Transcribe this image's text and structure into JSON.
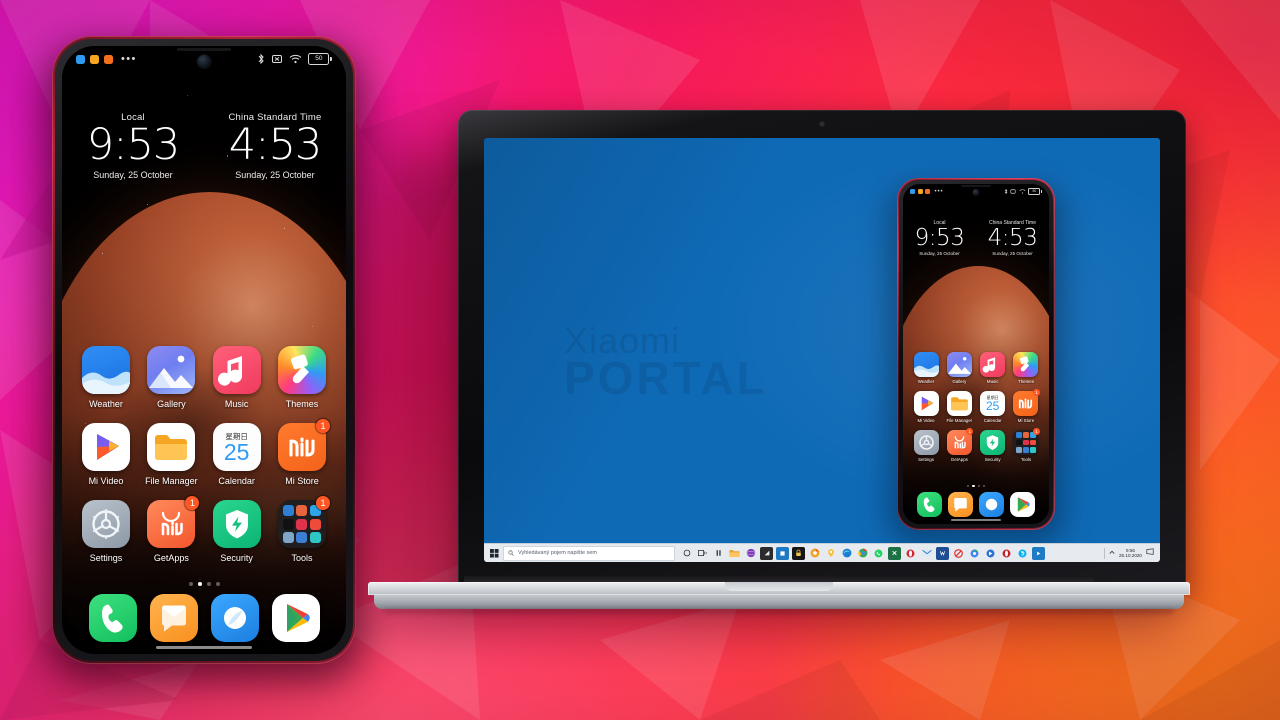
{
  "scene": {
    "title": "Xiaomi Mi Portal screen mirroring promo",
    "background_colors": {
      "magenta": "#ef1bbd",
      "red": "#fa1f3c",
      "orange": "#ff6a1e"
    }
  },
  "phone": {
    "status_bar": {
      "left_chips": [
        "#2e9bf0",
        "#f5a623",
        "#f5701e"
      ],
      "overflow_dots": "•••",
      "right_icons": [
        "bluetooth-icon",
        "vibrate-icon",
        "wifi-icon",
        "battery-icon"
      ],
      "battery_level": "50"
    },
    "clocks": [
      {
        "zone": "Local",
        "time": "9:53",
        "date": "Sunday, 25 October"
      },
      {
        "zone": "China Standard Time",
        "time": "4:53",
        "date": "Sunday, 25 October"
      }
    ],
    "apps": [
      [
        {
          "label": "Weather",
          "icon": "weather-icon",
          "badge": null
        },
        {
          "label": "Gallery",
          "icon": "gallery-icon",
          "badge": null
        },
        {
          "label": "Music",
          "icon": "music-icon",
          "badge": null
        },
        {
          "label": "Themes",
          "icon": "themes-icon",
          "badge": null
        }
      ],
      [
        {
          "label": "Mi Video",
          "icon": "mi-video-icon",
          "badge": null
        },
        {
          "label": "File Manager",
          "icon": "file-manager-icon",
          "badge": null
        },
        {
          "label": "Calendar",
          "icon": "calendar-icon",
          "badge": null,
          "day_label": "星期日",
          "day_number": "25"
        },
        {
          "label": "Mi Store",
          "icon": "mi-store-icon",
          "badge": "1"
        }
      ],
      [
        {
          "label": "Settings",
          "icon": "settings-icon",
          "badge": null
        },
        {
          "label": "GetApps",
          "icon": "getapps-icon",
          "badge": "1"
        },
        {
          "label": "Security",
          "icon": "security-icon",
          "badge": null
        },
        {
          "label": "Tools",
          "icon": "tools-folder-icon",
          "badge": "1"
        }
      ]
    ],
    "page_dots": {
      "count": 4,
      "active_index": 1
    },
    "dock": [
      {
        "label": "Phone",
        "icon": "phone-icon"
      },
      {
        "label": "Messages",
        "icon": "messages-icon"
      },
      {
        "label": "Browser",
        "icon": "browser-icon"
      },
      {
        "label": "Play Store",
        "icon": "play-store-icon"
      }
    ],
    "search_bar": {
      "search_icon": "search-icon",
      "assistant_icon": "assistant-icon"
    }
  },
  "laptop": {
    "screen": {
      "background_color": "#0f6ab6",
      "watermark_line1": "Xiaomi",
      "watermark_line2": "PORTAL"
    },
    "taskbar": {
      "start_icon": "windows-start-icon",
      "search_placeholder": "Vyhledávaný pojem napište sem",
      "search_icon": "search-icon",
      "pinned_icons": [
        {
          "name": "cortana-icon",
          "color": "#e7ebf0",
          "glyph": "◯"
        },
        {
          "name": "task-view-icon",
          "color": "#e7ebf0",
          "glyph": "❑"
        },
        {
          "name": "widgets-icon",
          "color": "#e7ebf0",
          "glyph": "‖"
        },
        {
          "name": "file-explorer-icon",
          "color": "#f2b544",
          "glyph": ""
        },
        {
          "name": "sphere-icon",
          "color": "#7b3fb5",
          "glyph": ""
        },
        {
          "name": "dark-app-icon",
          "color": "#2b2b2b",
          "glyph": "◥"
        },
        {
          "name": "teams-icon",
          "color": "#1f7ac4",
          "glyph": "■"
        },
        {
          "name": "lock-app-icon",
          "color": "#1a1a1a",
          "glyph": "🔒"
        },
        {
          "name": "chrome-canary-icon",
          "color": "#f05a28",
          "glyph": ""
        },
        {
          "name": "maps-pin-icon",
          "color": "#f7c948",
          "glyph": ""
        },
        {
          "name": "edge-icon",
          "color": "#1a7fd4",
          "glyph": ""
        },
        {
          "name": "chrome-icon",
          "color": "#ea4335",
          "glyph": ""
        },
        {
          "name": "whatsapp-icon",
          "color": "#25d366",
          "glyph": ""
        },
        {
          "name": "excel-icon",
          "color": "#1e7145",
          "glyph": ""
        },
        {
          "name": "opera-icon",
          "color": "#d6232c",
          "glyph": ""
        },
        {
          "name": "mail-icon",
          "color": "#1665c0",
          "glyph": ""
        },
        {
          "name": "word-icon",
          "color": "#1e4d91",
          "glyph": ""
        },
        {
          "name": "no-entry-icon",
          "color": "#e03131",
          "glyph": ""
        },
        {
          "name": "chrome-beta-icon",
          "color": "#4285f4",
          "glyph": ""
        },
        {
          "name": "store-icon",
          "color": "#2b6fd0",
          "glyph": ""
        },
        {
          "name": "opera-gx-icon",
          "color": "#c5202a",
          "glyph": ""
        },
        {
          "name": "skype-icon",
          "color": "#00aff0",
          "glyph": ""
        },
        {
          "name": "media-player-icon",
          "color": "#1f7ac4",
          "glyph": "▶"
        }
      ],
      "tray": {
        "show_hidden_icon": "chevron-up-icon",
        "clock_time": "9:56",
        "clock_date": "25.10.2020",
        "notifications_icon": "action-center-icon"
      }
    }
  },
  "mirror": {
    "status_bar": {
      "left_chips": [
        "#2e9bf0",
        "#f5a623",
        "#f5701e"
      ],
      "overflow_dots": "•••",
      "battery_level": "50"
    },
    "clocks": [
      {
        "zone": "Local",
        "time": "9:53",
        "date": "Sunday, 25 October"
      },
      {
        "zone": "China Standard Time",
        "time": "4:53",
        "date": "Sunday, 25 October"
      }
    ],
    "apps": [
      [
        {
          "label": "Weather",
          "icon": "weather-icon",
          "badge": null
        },
        {
          "label": "Gallery",
          "icon": "gallery-icon",
          "badge": null
        },
        {
          "label": "Music",
          "icon": "music-icon",
          "badge": null
        },
        {
          "label": "Themes",
          "icon": "themes-icon",
          "badge": null
        }
      ],
      [
        {
          "label": "Mi Video",
          "icon": "mi-video-icon",
          "badge": null
        },
        {
          "label": "File Manager",
          "icon": "file-manager-icon",
          "badge": null
        },
        {
          "label": "Calendar",
          "icon": "calendar-icon",
          "badge": null,
          "day_label": "星期日",
          "day_number": "25"
        },
        {
          "label": "Mi Store",
          "icon": "mi-store-icon",
          "badge": "1"
        }
      ],
      [
        {
          "label": "Settings",
          "icon": "settings-icon",
          "badge": null
        },
        {
          "label": "GetApps",
          "icon": "getapps-icon",
          "badge": "1"
        },
        {
          "label": "Security",
          "icon": "security-icon",
          "badge": null
        },
        {
          "label": "Tools",
          "icon": "tools-folder-icon",
          "badge": "1"
        }
      ]
    ],
    "page_dots": {
      "count": 4,
      "active_index": 1
    },
    "dock": [
      {
        "label": "Phone",
        "icon": "phone-icon"
      },
      {
        "label": "Messages",
        "icon": "messages-icon"
      },
      {
        "label": "Browser",
        "icon": "browser-icon"
      },
      {
        "label": "Play Store",
        "icon": "play-store-icon"
      }
    ]
  }
}
